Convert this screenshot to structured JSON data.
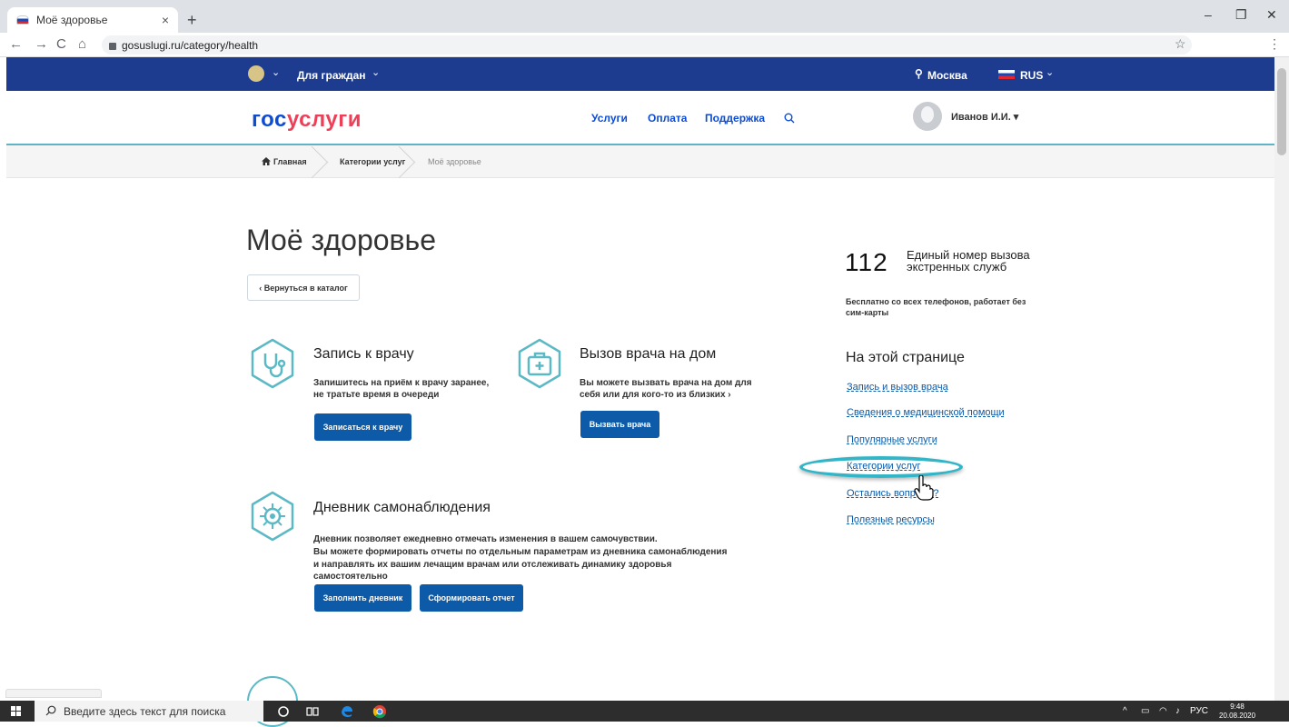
{
  "browser": {
    "tab_title": "Моё здоровье",
    "new_tab": "+",
    "close_tab": "×",
    "url": "gosuslugi.ru/category/health",
    "back": "←",
    "forward": "→",
    "reload": "C",
    "home": "⌂",
    "star": "☆",
    "menu": "⋮",
    "minimize": "–",
    "restore": "❐",
    "close": "✕"
  },
  "topnav": {
    "for_citizens": "Для граждан",
    "city": "Москва",
    "language": "RUS",
    "chevron": "⌄"
  },
  "header": {
    "logo_part1": "гос",
    "logo_part2": "услуги",
    "nav": [
      "Услуги",
      "Оплата",
      "Поддержка"
    ],
    "user_name": "Иванов И.И. ▾"
  },
  "breadcrumbs": [
    "Главная",
    "Категории услуг",
    "Моё здоровье"
  ],
  "page": {
    "title": "Моё здоровье",
    "back_button": "‹ Вернуться в каталог"
  },
  "services": [
    {
      "title": "Запись к врачу",
      "desc": "Запишитесь на приём к врачу заранее, не тратьте время в очереди",
      "buttons": [
        "Записаться к врачу"
      ]
    },
    {
      "title": "Вызов врача на дом",
      "desc": "Вы можете вызвать врача на дом для себя или для кого-то из близких ›",
      "buttons": [
        "Вызвать врача"
      ]
    },
    {
      "title": "Дневник самонаблюдения",
      "desc_lines": [
        "Дневник позволяет ежедневно отмечать изменения в вашем самочувствии.",
        "Вы можете формировать отчеты по отдельным параметрам из дневника самонаблюдения",
        "и направлять их вашим лечащим врачам или отслеживать динамику здоровья самостоятельно"
      ],
      "buttons": [
        "Заполнить дневник",
        "Сформировать отчет"
      ]
    }
  ],
  "emergency": {
    "number": "112",
    "label": "Единый номер вызова экстренных служб",
    "note": "Бесплатно со всех телефонов, работает без сим-карты"
  },
  "on_this_page": {
    "title": "На этой странице",
    "links": [
      "Запись и вызов врача",
      "Сведения о медицинской помощи",
      "Популярные услуги",
      "Категории услуг",
      "Остались вопросы?",
      "Полезные ресурсы"
    ]
  },
  "taskbar": {
    "search_placeholder": "Введите здесь текст для поиска",
    "language": "РУС",
    "time": "9:48",
    "date": "20.08.2020"
  },
  "colors": {
    "gov_blue": "#1d3b8f",
    "logo_blue": "#0d4cd3",
    "logo_red": "#ee3f58",
    "button_blue": "#0d5aa8",
    "icon_teal": "#5bb9c6",
    "highlight": "#32b5c7"
  }
}
